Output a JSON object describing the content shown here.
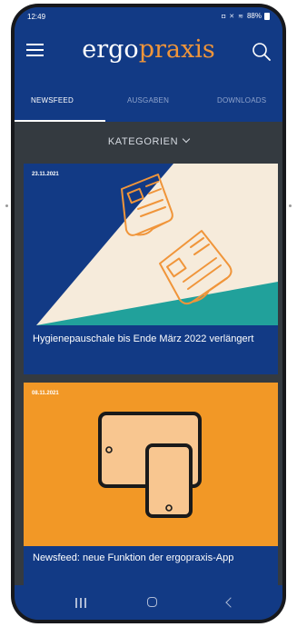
{
  "status": {
    "time": "12:49",
    "icons": "◘ ✕ ≋",
    "battery": "88%"
  },
  "header": {
    "logo_part1": "ergo",
    "logo_part2": "praxis"
  },
  "tabs": [
    {
      "label": "NEWSFEED",
      "active": true
    },
    {
      "label": "AUSGABEN",
      "active": false
    },
    {
      "label": "DOWNLOADS",
      "active": false
    }
  ],
  "filter": {
    "label": "KATEGORIEN"
  },
  "articles": [
    {
      "date": "23.11.2021",
      "title": "Hygienepauschale bis Ende März 2022 verlängert"
    },
    {
      "date": "08.11.2021",
      "title": "Newsfeed: neue Funktion der ergopraxis-App"
    }
  ],
  "colors": {
    "primary": "#123a85",
    "accent": "#f0953a",
    "background": "#343a40",
    "card_teal": "#21a19b",
    "card_cream": "#f6ebdb"
  },
  "icons": {
    "menu": "hamburger-icon",
    "search": "search-icon",
    "filter_chevron": "chevron-down-icon",
    "nav_recent": "recent-apps-icon",
    "nav_home": "home-icon",
    "nav_back": "back-icon"
  }
}
